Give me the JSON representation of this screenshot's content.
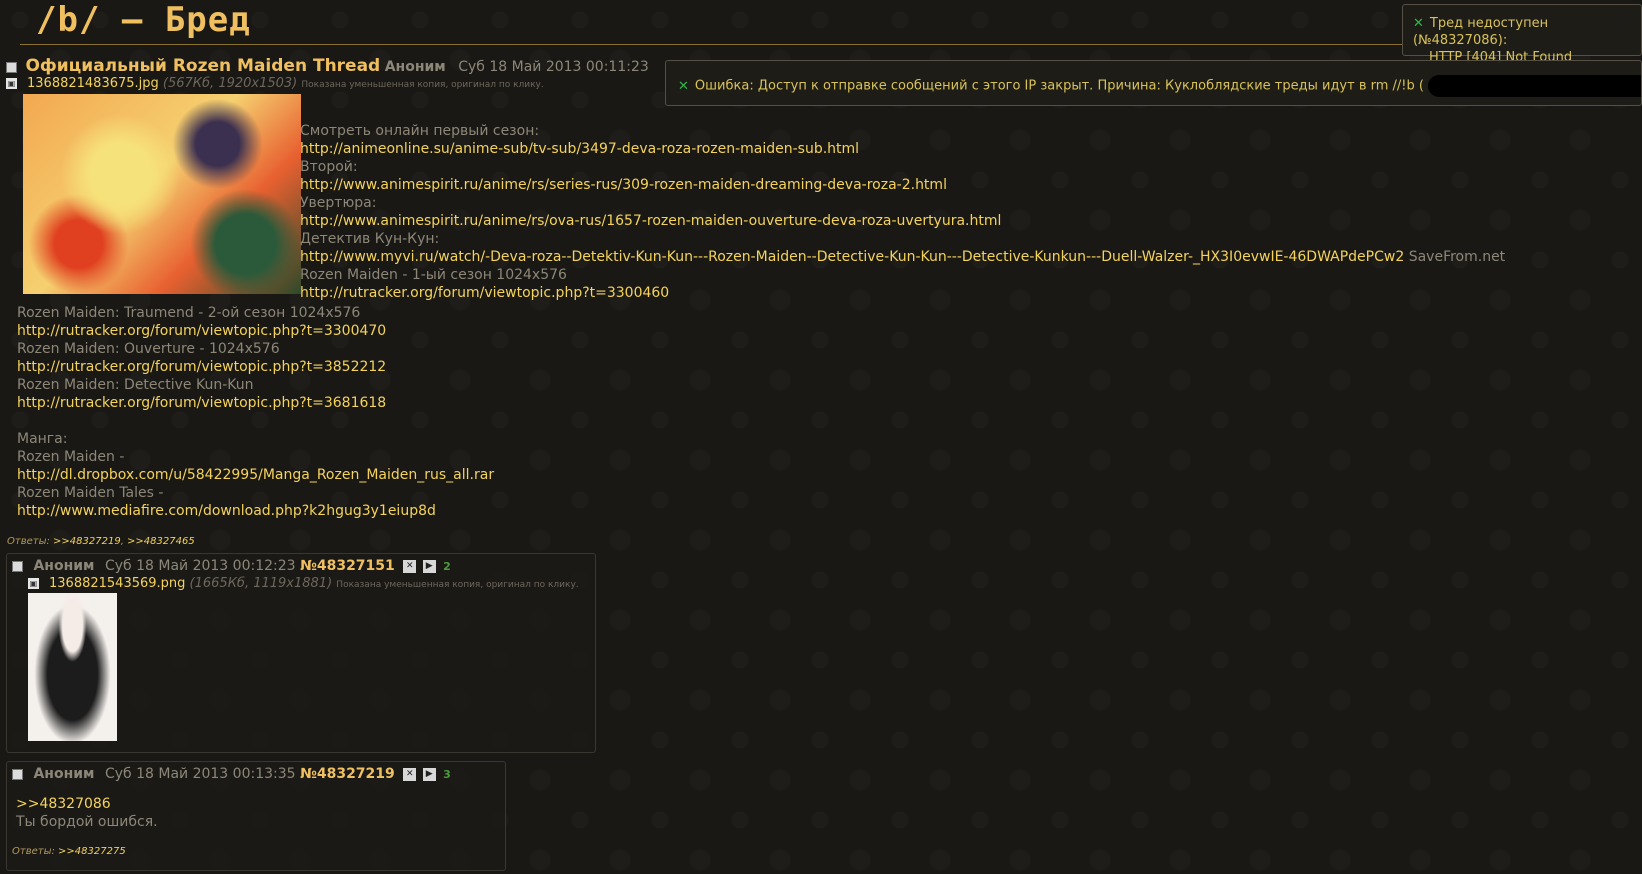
{
  "board": {
    "title": "/b/ – Бред"
  },
  "notices": {
    "not_found": {
      "line1": "Тред недоступен (№48327086):",
      "line2": "HTTP [404] Not Found"
    },
    "error": {
      "text": "Ошибка: Доступ к отправке сообщений с этого IP закрыт. Причина: Куклоблядские треды идут в rm //!b ("
    }
  },
  "op": {
    "subject": "Официальный Rozen Maiden Thread",
    "name": "Аноним",
    "date": "Суб 18 Май 2013 00:11:23",
    "file": {
      "name": "1368821483675.jpg",
      "meta": "(567Кб, 1920x1503)",
      "hint": "Показана уменьшенная копия, оригинал по клику."
    },
    "lines": [
      {
        "t": "Смотреть онлайн первый сезон:",
        "link": false
      },
      {
        "t": "http://animeonline.su/anime-sub/tv-sub/3497-deva-roza-rozen-maiden-sub.html",
        "link": true
      },
      {
        "t": "Второй:",
        "link": false
      },
      {
        "t": "http://www.animespirit.ru/anime/rs/series-rus/309-rozen-maiden-dreaming-deva-roza-2.html",
        "link": true
      },
      {
        "t": "Увертюра:",
        "link": false
      },
      {
        "t": "http://www.animespirit.ru/anime/rs/ova-rus/1657-rozen-maiden-ouverture-deva-roza-uvertyura.html",
        "link": true
      },
      {
        "t": "Детектив Кун-Кун:",
        "link": false
      },
      {
        "t": "http://www.myvi.ru/watch/-Deva-roza--Detektiv-Kun-Kun---Rozen-Maiden--Detective-Kun-Kun---Detective-Kunkun---Duell-Walzer-_HX3I0evwIE-46DWAPdePCw2",
        "link": true,
        "suffix": " SaveFrom.net"
      },
      {
        "t": "Rozen Maiden - 1-ый сезон 1024x576",
        "link": false
      },
      {
        "t": "http://rutracker.org/forum/viewtopic.php?t=3300460",
        "link": true
      }
    ],
    "lines2": [
      {
        "t": "Rozen Maiden: Traumend - 2-ой сезон 1024x576",
        "link": false
      },
      {
        "t": "http://rutracker.org/forum/viewtopic.php?t=3300470",
        "link": true
      },
      {
        "t": "Rozen Maiden: Ouverture - 1024x576",
        "link": false
      },
      {
        "t": "http://rutracker.org/forum/viewtopic.php?t=3852212",
        "link": true
      },
      {
        "t": "Rozen Maiden: Detective Kun-Kun",
        "link": false
      },
      {
        "t": "http://rutracker.org/forum/viewtopic.php?t=3681618",
        "link": true
      },
      {
        "t": "",
        "link": false
      },
      {
        "t": "Манга:",
        "link": false
      },
      {
        "t": "Rozen Maiden -",
        "link": false
      },
      {
        "t": "http://dl.dropbox.com/u/58422995/Manga_Rozen_Maiden_rus_all.rar",
        "link": true
      },
      {
        "t": "Rozen Maiden Tales -",
        "link": false
      },
      {
        "t": "http://www.mediafire.com/download.php?k2hgug3y1eiup8d",
        "link": true
      }
    ],
    "replies_label": "Ответы:",
    "replies": [
      ">>48327219",
      ">>48327465"
    ]
  },
  "reply1": {
    "name": "Аноним",
    "date": "Суб 18 Май 2013 00:12:23",
    "num": "№48327151",
    "count": "2",
    "file": {
      "name": "1368821543569.png",
      "meta": "(1665Кб, 1119x1881)",
      "hint": "Показана уменьшенная копия, оригинал по клику."
    }
  },
  "reply2": {
    "name": "Аноним",
    "date": "Суб 18 Май 2013 00:13:35",
    "num": "№48327219",
    "count": "3",
    "quote": ">>48327086",
    "text": "Ты бордой ошибся.",
    "replies_label": "Ответы:",
    "replies": [
      ">>48327275"
    ]
  },
  "icons": {
    "hide": "✕",
    "expand": "▶",
    "file": "▣",
    "close": "✕"
  },
  "colors": {
    "accent": "#f0c060",
    "link": "#f4d35c",
    "text": "#8c8778",
    "ok": "#2fb84a"
  }
}
